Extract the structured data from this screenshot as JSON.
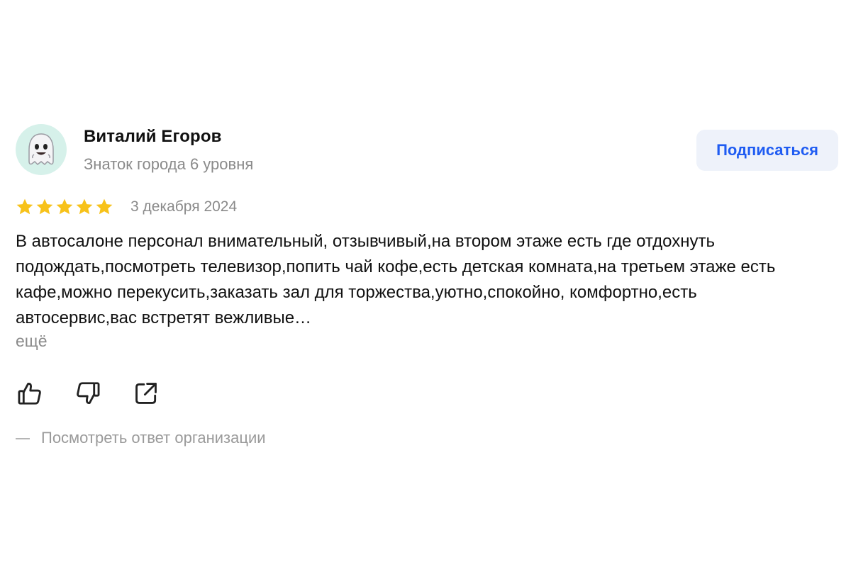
{
  "author": {
    "name": "Виталий Егоров",
    "level": "Знаток города 6 уровня",
    "avatar_icon": "ghost-emoji"
  },
  "subscribe_label": "Подписаться",
  "rating": {
    "stars": 5,
    "max": 5,
    "color": "#f7c21a"
  },
  "date": "3 декабря 2024",
  "text": "В автосалоне персонал внимательный, отзывчивый,на втором этаже есть где отдохнуть подождать,посмотреть телевизор,попить чай кофе,есть детская комната,на третьем этаже есть кафе,можно перекусить,заказать зал для торжества,уютно,спокойно, комфортно,есть автосервис,вас встретят вежливые…",
  "more_label": "ещё",
  "actions": [
    {
      "name": "like-icon"
    },
    {
      "name": "dislike-icon"
    },
    {
      "name": "share-icon"
    }
  ],
  "org_answer_label": "Посмотреть ответ организации",
  "colors": {
    "accent": "#1f5cf2",
    "muted": "#8a8a8a",
    "button_bg": "#eef2fa"
  }
}
